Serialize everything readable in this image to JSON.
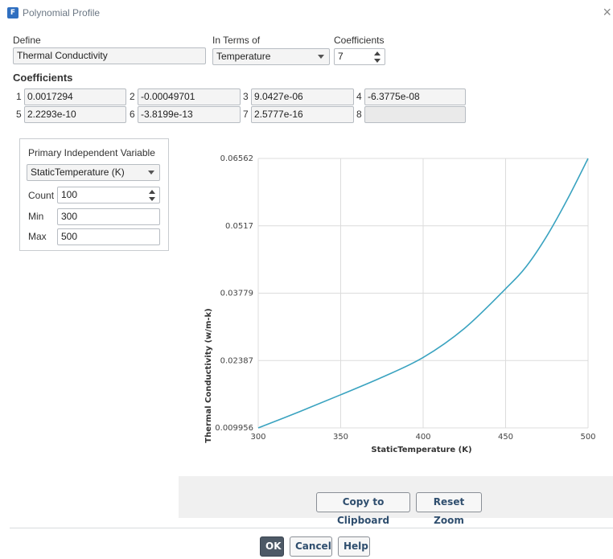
{
  "window": {
    "title": "Polynomial Profile",
    "close_glyph": "×",
    "icon_glyph": "F"
  },
  "define": {
    "label": "Define",
    "value": "Thermal Conductivity"
  },
  "in_terms_of": {
    "label": "In Terms of",
    "value": "Temperature"
  },
  "coefficients_count": {
    "label": "Coefficients",
    "value": "7"
  },
  "coefficients": {
    "heading": "Coefficients",
    "items": [
      {
        "num": "1",
        "value": "0.0017294"
      },
      {
        "num": "2",
        "value": "-0.00049701"
      },
      {
        "num": "3",
        "value": "9.0427e-06"
      },
      {
        "num": "4",
        "value": "-6.3775e-08"
      },
      {
        "num": "5",
        "value": "2.2293e-10"
      },
      {
        "num": "6",
        "value": "-3.8199e-13"
      },
      {
        "num": "7",
        "value": "2.5777e-16"
      },
      {
        "num": "8",
        "value": ""
      }
    ]
  },
  "piv": {
    "label": "Primary Independent Variable",
    "value": "StaticTemperature (K)",
    "count_label": "Count",
    "count_value": "100",
    "min_label": "Min",
    "min_value": "300",
    "max_label": "Max",
    "max_value": "500"
  },
  "chart_data": {
    "type": "line",
    "xlabel": "StaticTemperature (K)",
    "ylabel": "Thermal Conductivity (w/m-k)",
    "xlim": [
      300,
      500
    ],
    "ylim": [
      0.009956,
      0.06562
    ],
    "x_ticks": [
      "300",
      "350",
      "400",
      "450",
      "500"
    ],
    "y_ticks": [
      "0.009956",
      "0.02387",
      "0.03779",
      "0.0517",
      "0.06562"
    ],
    "grid": true,
    "series": [
      {
        "color": "#3aa3c0",
        "x": [
          300,
          325,
          350,
          375,
          400,
          425,
          450,
          462.5,
          475,
          487.5,
          500
        ],
        "y": [
          0.009956,
          0.0133,
          0.0168,
          0.0204,
          0.0245,
          0.0305,
          0.0387,
          0.0433,
          0.0496,
          0.0572,
          0.06562
        ]
      }
    ]
  },
  "chart_buttons": {
    "copy": "Copy to Clipboard",
    "reset": "Reset Zoom"
  },
  "dialog_buttons": {
    "ok": "OK",
    "cancel": "Cancel",
    "help": "Help"
  }
}
